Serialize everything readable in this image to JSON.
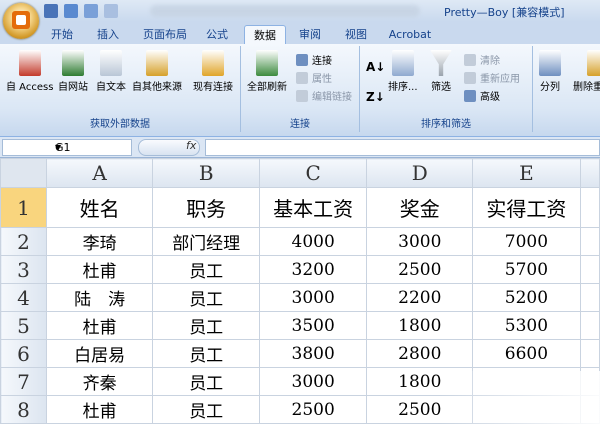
{
  "window": {
    "title": "Pretty—Boy [兼容模式]"
  },
  "tabs": [
    "开始",
    "插入",
    "页面布局",
    "公式",
    "数据",
    "审阅",
    "视图",
    "Acrobat"
  ],
  "active_tab": "数据",
  "ribbon": {
    "group_external": {
      "label": "获取外部数据",
      "buttons": [
        "自 Access",
        "自网站",
        "自文本",
        "自其他来源",
        "现有连接"
      ]
    },
    "group_connections": {
      "label": "连接",
      "refresh": "全部刷新",
      "items": [
        "连接",
        "属性",
        "编辑链接"
      ]
    },
    "group_sort": {
      "label": "排序和筛选",
      "sort": "排序...",
      "filter": "筛选",
      "items": [
        "清除",
        "重新应用",
        "高级"
      ]
    },
    "group_tools": {
      "buttons": [
        "分列",
        "删除重复项"
      ]
    }
  },
  "formula_bar": {
    "name_box": "G1",
    "fx": "fx",
    "formula": ""
  },
  "columns": [
    "A",
    "B",
    "C",
    "D",
    "E"
  ],
  "rows": [
    "1",
    "2",
    "3",
    "4",
    "5",
    "6",
    "7",
    "8"
  ],
  "table": {
    "header": [
      "姓名",
      "职务",
      "基本工资",
      "奖金",
      "实得工资"
    ],
    "data": [
      [
        "李琦",
        "部门经理",
        "4000",
        "3000",
        "7000"
      ],
      [
        "杜甫",
        "员工",
        "3200",
        "2500",
        "5700"
      ],
      [
        "陆　涛",
        "员工",
        "3000",
        "2200",
        "5200"
      ],
      [
        "杜甫",
        "员工",
        "3500",
        "1800",
        "5300"
      ],
      [
        "白居易",
        "员工",
        "3800",
        "2800",
        "6600"
      ],
      [
        "齐秦",
        "员工",
        "3000",
        "1800",
        ""
      ],
      [
        "杜甫",
        "员工",
        "2500",
        "2500",
        ""
      ]
    ]
  }
}
